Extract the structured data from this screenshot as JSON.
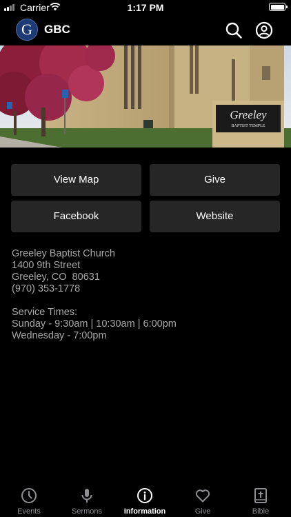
{
  "status_bar": {
    "carrier": "Carrier",
    "time": "1:17 PM"
  },
  "header": {
    "logo_letter": "G",
    "title": "GBC"
  },
  "hero": {
    "sign_title": "Greeley",
    "sign_subtitle": "BAPTIST TEMPLE"
  },
  "buttons": {
    "view_map": "View Map",
    "give": "Give",
    "facebook": "Facebook",
    "website": "Website"
  },
  "info": {
    "address_lines": [
      "Greeley Baptist Church",
      "1400 9th Street",
      "Greeley, CO  80631",
      "(970) 353-1778"
    ],
    "service_heading": "Service Times:",
    "service_lines": [
      "Sunday - 9:30am | 10:30am | 6:00pm",
      "Wednesday - 7:00pm"
    ]
  },
  "tabs": [
    {
      "label": "Events",
      "icon": "clock-icon",
      "active": false
    },
    {
      "label": "Sermons",
      "icon": "microphone-icon",
      "active": false
    },
    {
      "label": "Information",
      "icon": "info-icon",
      "active": true
    },
    {
      "label": "Give",
      "icon": "heart-icon",
      "active": false
    },
    {
      "label": "Bible",
      "icon": "bible-icon",
      "active": false
    }
  ],
  "colors": {
    "background": "#000000",
    "button": "#262626",
    "info_text": "#a8a8a8",
    "logo": "#1c3a73",
    "inactive_tab": "#8e8e93"
  }
}
